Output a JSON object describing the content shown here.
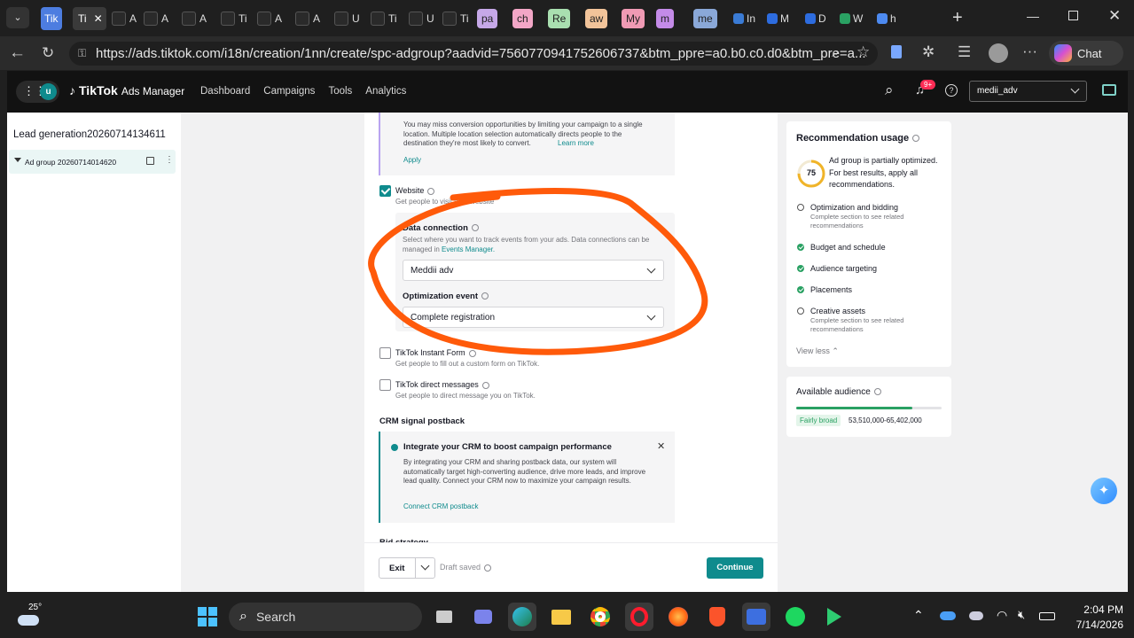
{
  "browser": {
    "tabs": [
      "Tik",
      "Ti",
      "A",
      "A",
      "A",
      "Ti",
      "A",
      "A",
      "U",
      "Ti",
      "U",
      "Ti"
    ],
    "color_tabs": [
      {
        "label": "pa",
        "color": "#c6a8e8"
      },
      {
        "label": "ch",
        "color": "#f2a6c6"
      },
      {
        "label": "Re",
        "color": "#a9dfb0"
      },
      {
        "label": "aw",
        "color": "#f2c49a"
      },
      {
        "label": "My",
        "color": "#f09ab4"
      },
      {
        "label": "m",
        "color": "#c48be8"
      },
      {
        "label": "me",
        "color": "#8aa8d8"
      },
      {
        "label": "In",
        "color": "#3a7bd5"
      },
      {
        "label": "M",
        "color": "#2d6cdf"
      },
      {
        "label": "D",
        "color": "#2d6cdf"
      },
      {
        "label": "W",
        "color": "#2aa163"
      },
      {
        "label": "h",
        "color": "#4d8af0"
      }
    ],
    "url": "https://ads.tiktok.com/i18n/creation/1nn/create/spc-adgroup?aadvid=7560770941752606737&btm_ppre=a0.b0.c0.d0&btm_pre=a...",
    "chat_label": "Chat"
  },
  "app": {
    "avatar_letter": "u",
    "brand": "TikTok",
    "brand_suffix": "Ads Manager",
    "nav": [
      "Dashboard",
      "Campaigns",
      "Tools",
      "Analytics"
    ],
    "notif_badge": "9+",
    "account": "medii_adv"
  },
  "sidebar": {
    "campaign_name": "Lead generation20260714134611",
    "adgroup_name": "Ad group 20260714014620"
  },
  "location_tip": {
    "text": "You may miss conversion opportunities by limiting your campaign to a single location. Multiple location selection automatically directs people to the destination they're most likely to convert.",
    "learn_more": "Learn more",
    "apply": "Apply"
  },
  "destination": {
    "website_label": "Website",
    "website_sub": "Get people to visit your website",
    "data_connection_label": "Data connection",
    "data_connection_help": "Select where you want to track events from your ads. Data connections can be managed in",
    "events_manager": "Events Manager.",
    "data_connection_value": "Meddii adv",
    "optimization_event_label": "Optimization event",
    "optimization_event_value": "Complete registration",
    "instant_form_label": "TikTok Instant Form",
    "instant_form_sub": "Get people to fill out a custom form on TikTok.",
    "dm_label": "TikTok direct messages",
    "dm_sub": "Get people to direct message you on TikTok."
  },
  "crm": {
    "section_title": "CRM signal postback",
    "title": "Integrate your CRM to boost campaign performance",
    "body": "By integrating your CRM and sharing postback data, our system will automatically target high-converting audience, drive more leads, and improve lead quality. Connect your CRM now to maximize your campaign results.",
    "link": "Connect CRM postback",
    "next_section": "Bid strategy"
  },
  "footer": {
    "exit": "Exit",
    "draft": "Draft saved",
    "continue": "Continue"
  },
  "recommendation": {
    "title": "Recommendation usage",
    "score": "75",
    "summary": "Ad group is partially optimized. For best results, apply all recommendations.",
    "items": [
      {
        "label": "Optimization and bidding",
        "sub": "Complete section to see related recommendations",
        "done": false
      },
      {
        "label": "Budget and schedule",
        "sub": "",
        "done": true
      },
      {
        "label": "Audience targeting",
        "sub": "",
        "done": true
      },
      {
        "label": "Placements",
        "sub": "",
        "done": true
      },
      {
        "label": "Creative assets",
        "sub": "Complete section to see related recommendations",
        "done": false
      }
    ],
    "view_less": "View less",
    "score_fraction": 0.75
  },
  "audience": {
    "title": "Available audience",
    "badge": "Fairly broad",
    "range": "53,510,000-65,402,000",
    "bar_fraction": 0.8
  },
  "taskbar": {
    "temp": "25°",
    "search": "Search",
    "time": "2:04 PM",
    "date": "7/14/2026"
  },
  "colors": {
    "accent": "#0f8b8d",
    "annotation": "#ff5a0a"
  }
}
